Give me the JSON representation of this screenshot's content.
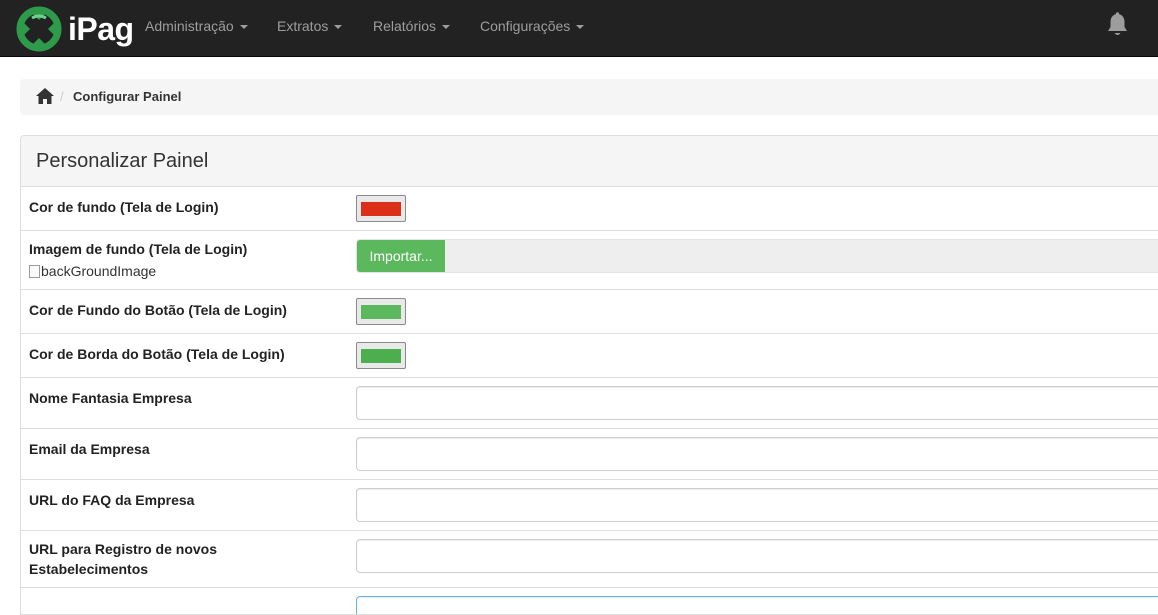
{
  "brand": {
    "name": "iPag"
  },
  "nav": {
    "items": [
      {
        "label": "Administração"
      },
      {
        "label": "Extratos"
      },
      {
        "label": "Relatórios"
      },
      {
        "label": "Configurações"
      }
    ],
    "icons": {
      "notifications": "bell-icon",
      "home": "home-icon"
    }
  },
  "breadcrumb": {
    "separator": "/",
    "current": "Configurar Painel"
  },
  "panel": {
    "title": "Personalizar Painel",
    "fields": {
      "bg_color": {
        "label": "Cor de fundo (Tela de Login)",
        "color": "#dc2f1a"
      },
      "bg_image": {
        "label": "Imagem de fundo (Tela de Login)",
        "button_label": "Importar...",
        "image_alt": "backGroundImage"
      },
      "btn_bg_color": {
        "label": "Cor de Fundo do Botão (Tela de Login)",
        "color": "#5cb85c"
      },
      "btn_border_color": {
        "label": "Cor de Borda do Botão (Tela de Login)",
        "color": "#4cae4c"
      },
      "company_name": {
        "label": "Nome Fantasia Empresa",
        "value": ""
      },
      "company_email": {
        "label": "Email da Empresa",
        "value": ""
      },
      "faq_url": {
        "label": "URL do FAQ da Empresa",
        "value": ""
      },
      "register_url": {
        "label": "URL para Registro de novos Estabelecimentos",
        "value": ""
      }
    }
  },
  "colors": {
    "navbar": "#222222",
    "accent_green": "#5cb85c",
    "brand_green": "#2f9e4f"
  }
}
